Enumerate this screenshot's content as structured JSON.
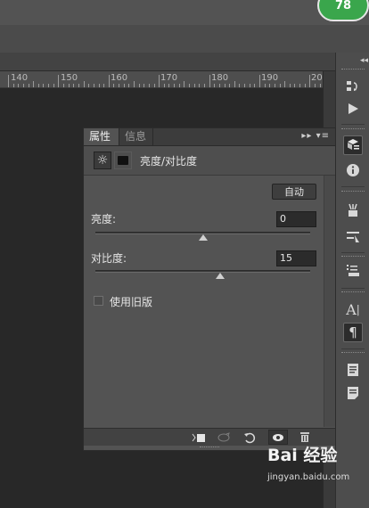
{
  "badge": {
    "count": "78"
  },
  "ruler": {
    "labels": [
      "140",
      "150",
      "160",
      "170",
      "180",
      "190",
      "20"
    ]
  },
  "panel": {
    "tabs": {
      "properties": "属性",
      "info": "信息"
    },
    "menu_glyph": "▸▸ ▾≡",
    "header_title": "亮度/对比度",
    "auto_button": "自动",
    "brightness": {
      "label": "亮度:",
      "value": "0",
      "level_percent": 50
    },
    "contrast": {
      "label": "对比度:",
      "value": "15",
      "level_percent": 58
    },
    "legacy_checkbox": {
      "label": "使用旧版",
      "checked": false
    }
  },
  "watermark": {
    "brand": "Bai 经验",
    "url": "jingyan.baidu.com"
  },
  "colors": {
    "badge_green": "#3aa64c",
    "panel_bg": "#535353",
    "canvas_bg": "#282828"
  }
}
